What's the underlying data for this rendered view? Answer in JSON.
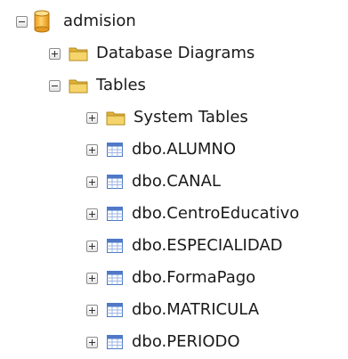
{
  "tree": {
    "database": {
      "label": "admision",
      "icon": "database-cylinder-icon",
      "expanded": true
    },
    "database_diagrams": {
      "label": "Database Diagrams",
      "icon": "folder-icon",
      "expanded": false
    },
    "tables": {
      "label": "Tables",
      "icon": "folder-icon",
      "expanded": true
    },
    "system_tables": {
      "label": "System Tables",
      "icon": "folder-icon",
      "expanded": false
    },
    "table_items": [
      {
        "label": "dbo.ALUMNO",
        "icon": "table-icon"
      },
      {
        "label": "dbo.CANAL",
        "icon": "table-icon"
      },
      {
        "label": "dbo.CentroEducativo",
        "icon": "table-icon"
      },
      {
        "label": "dbo.ESPECIALIDAD",
        "icon": "table-icon"
      },
      {
        "label": "dbo.FormaPago",
        "icon": "table-icon"
      },
      {
        "label": "dbo.MATRICULA",
        "icon": "table-icon"
      },
      {
        "label": "dbo.PERIODO",
        "icon": "table-icon"
      }
    ]
  },
  "colors": {
    "folder": "#f2c94c",
    "database": "#f3b43a",
    "table": "#4e79c8",
    "toggle_border": "#8c8c8c"
  }
}
